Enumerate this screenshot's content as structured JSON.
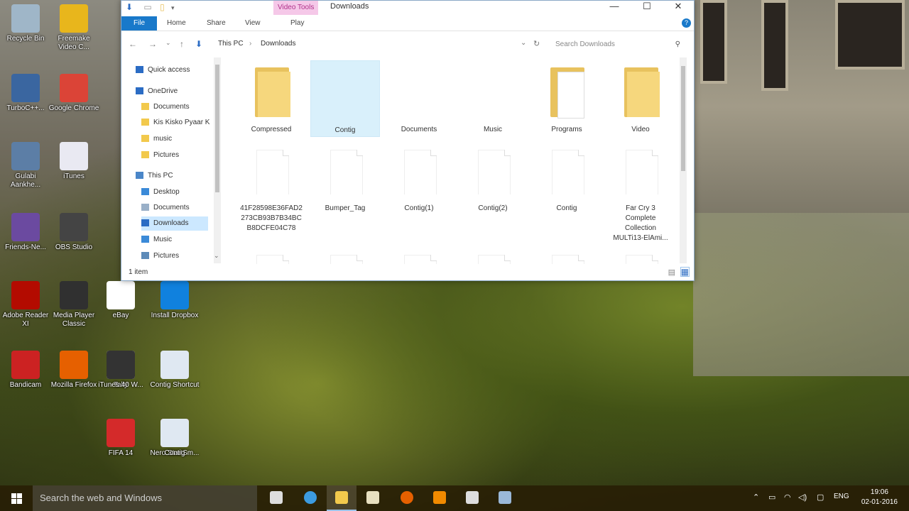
{
  "desktop": {
    "icons": [
      {
        "label": "Recycle Bin",
        "color": "#9fb6c8"
      },
      {
        "label": "Freemake Video C...",
        "color": "#e8b61c"
      },
      {
        "label": "TurboC++...",
        "color": "#3a66a0"
      },
      {
        "label": "Google Chrome",
        "color": "#db4437"
      },
      {
        "label": "Gulabi Aankhe...",
        "color": "#5c7ea6"
      },
      {
        "label": "iTunes",
        "color": "#e9e9f2"
      },
      {
        "label": "Friends-Ne...",
        "color": "#6b4aa0"
      },
      {
        "label": "OBS Studio",
        "color": "#444444"
      },
      {
        "label": "Adobe Reader XI",
        "color": "#b30b00"
      },
      {
        "label": "Media Player Classic",
        "color": "#303030"
      },
      {
        "label": "eBay",
        "color": "#ffffff"
      },
      {
        "label": "Install Dropbox",
        "color": "#1081de"
      },
      {
        "label": "Bandicam",
        "color": "#cc2222"
      },
      {
        "label": "Mozilla Firefox",
        "color": "#e66000"
      },
      {
        "label": "Tally",
        "color": "#ffffff"
      },
      {
        "label": "Contig Shortcut",
        "color": "#dfe8f2"
      },
      {
        "label": "FIFA 14",
        "color": "#d42a2a"
      },
      {
        "label": "Nero StartSm...",
        "color": "#c03030"
      },
      {
        "label": "iTunes 40 W...",
        "color": "#333333"
      },
      {
        "label": "Contig",
        "color": "#dfe8f2"
      }
    ]
  },
  "explorer": {
    "context_tab": "Video Tools",
    "title": "Downloads",
    "window_buttons": {
      "minimize": "—",
      "maximize": "☐",
      "close": "✕"
    },
    "qat_icons": [
      "⬇",
      "▭",
      "▯",
      "▾"
    ],
    "ribbon": {
      "file": "File",
      "tabs": [
        "Home",
        "Share",
        "View",
        "Play"
      ],
      "help": "?"
    },
    "address": {
      "back": "←",
      "forward": "→",
      "recent": "⌄",
      "up": "↑",
      "crumbs": [
        "This PC",
        "›",
        "Downloads"
      ],
      "refresh": "↻",
      "dropdown": "⌄"
    },
    "search": {
      "placeholder": "Search Downloads",
      "icon": "⚲"
    },
    "nav": {
      "items": [
        {
          "label": "Quick access",
          "icon": "star-icon",
          "color": "#2b6cc4",
          "depth": 0
        },
        {
          "label": "OneDrive",
          "icon": "cloud-icon",
          "color": "#2b6cc4",
          "depth": 0
        },
        {
          "label": "Documents",
          "icon": "folder-icon",
          "color": "#f2c94c",
          "depth": 1
        },
        {
          "label": "Kis Kisko Pyaar K",
          "icon": "folder-icon",
          "color": "#f2c94c",
          "depth": 1
        },
        {
          "label": "music",
          "icon": "folder-icon",
          "color": "#f2c94c",
          "depth": 1
        },
        {
          "label": "Pictures",
          "icon": "folder-icon",
          "color": "#f2c94c",
          "depth": 1
        },
        {
          "label": "This PC",
          "icon": "computer-icon",
          "color": "#4a86c8",
          "depth": 0
        },
        {
          "label": "Desktop",
          "icon": "desktop-icon",
          "color": "#3b8ad8",
          "depth": 1
        },
        {
          "label": "Documents",
          "icon": "documents-icon",
          "color": "#9ab0c8",
          "depth": 1
        },
        {
          "label": "Downloads",
          "icon": "download-icon",
          "color": "#2b6cc4",
          "depth": 1,
          "selected": true
        },
        {
          "label": "Music",
          "icon": "music-icon",
          "color": "#3b8ad8",
          "depth": 1
        },
        {
          "label": "Pictures",
          "icon": "pictures-icon",
          "color": "#5c8ab8",
          "depth": 1
        }
      ],
      "scroll_down": "⌄"
    },
    "folders": [
      {
        "label": "Compressed",
        "kind": "folder"
      },
      {
        "label": "Contig",
        "kind": "blank",
        "selected": true
      },
      {
        "label": "Documents",
        "kind": "blank"
      },
      {
        "label": "Music",
        "kind": "blank"
      },
      {
        "label": "Programs",
        "kind": "folder-open"
      },
      {
        "label": "Video",
        "kind": "folder"
      }
    ],
    "files": [
      {
        "lines": [
          "41F28598E36FAD2",
          "273CB93B7B34BC",
          "B8DCFE04C78"
        ]
      },
      {
        "lines": [
          "Bumper_Tag"
        ]
      },
      {
        "lines": [
          "Contig(1)"
        ]
      },
      {
        "lines": [
          "Contig(2)"
        ]
      },
      {
        "lines": [
          "Contig"
        ]
      },
      {
        "lines": [
          "Far Cry 3",
          "Complete",
          "Collection",
          "MULTi13-ElAmi..."
        ]
      }
    ],
    "status": {
      "text": "1 item",
      "view_icons": [
        "▤",
        "▦"
      ]
    }
  },
  "taskbar": {
    "search_placeholder": "Search the web and Windows",
    "apps": [
      {
        "name": "task-view",
        "color": "#dddddd"
      },
      {
        "name": "internet-explorer",
        "color": "#3c9be0"
      },
      {
        "name": "file-explorer",
        "color": "#f2c94c",
        "active": true
      },
      {
        "name": "media-player",
        "color": "#e8e0c0"
      },
      {
        "name": "firefox",
        "color": "#e66000"
      },
      {
        "name": "vlc",
        "color": "#f08a00"
      },
      {
        "name": "photos",
        "color": "#dddddd"
      },
      {
        "name": "remote-app",
        "color": "#9ab8d8"
      }
    ],
    "tray": {
      "chevron": "⌃",
      "network": "▭",
      "wifi": "◠",
      "volume": "◁)",
      "message": "▢",
      "language": "ENG"
    },
    "clock": {
      "time": "19:06",
      "date": "02-01-2016"
    }
  }
}
